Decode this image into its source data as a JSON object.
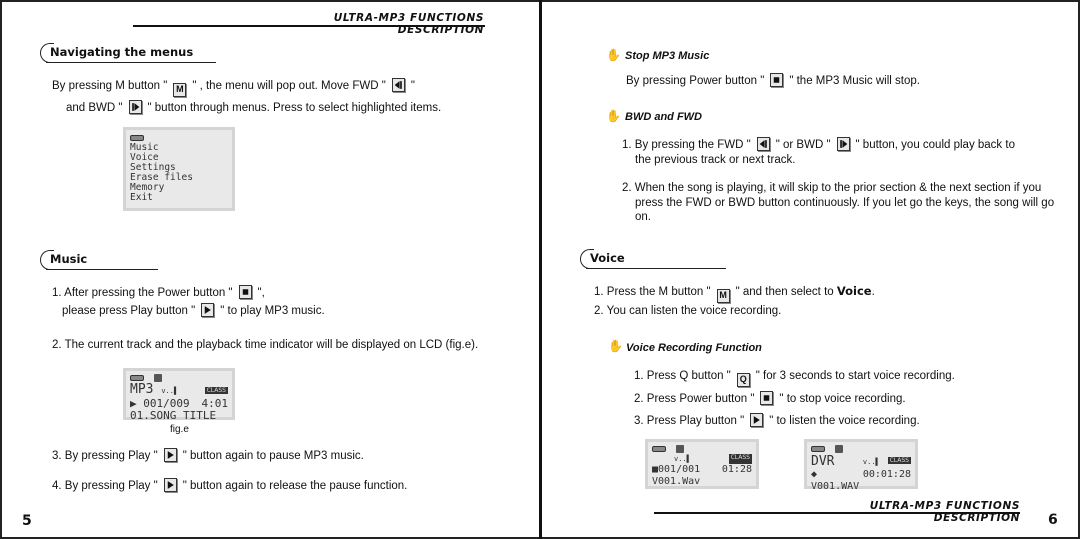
{
  "document": {
    "header_title": "ULTRA-MP3 FUNCTIONS DESCRIPTION",
    "left_page_number": "5",
    "right_page_number": "6"
  },
  "left": {
    "nav_section": {
      "title": "Navigating the menus",
      "line1_a": "By pressing M button \"",
      "line1_btn": "M",
      "line1_b": "\" , the menu will pop out. Move FWD \"",
      "line1_c": "\"",
      "line2_a": "and BWD \"",
      "line2_b": "\" button through menus. Press to select highlighted items."
    },
    "menu_lcd": {
      "items": [
        "Music",
        "Voice",
        "Settings",
        "Erase files",
        "Memory",
        "Exit"
      ]
    },
    "music_section": {
      "title": "Music",
      "step1_a": "1. After pressing the Power  button \"",
      "step1_b": "\",",
      "step1_c": "please press Play  button \"",
      "step1_d": "\" to play MP3 music.",
      "step2": "2. The current track and the playback time indicator will be displayed on LCD (fig.e).",
      "step3_a": "3. By pressing Play \"",
      "step3_b": "\" button again to pause MP3 music.",
      "step4_a": "4. By pressing Play \"",
      "step4_b": "\" button again to release the pause function."
    },
    "fig_e": {
      "mode": "MP3",
      "signal": "v..▌",
      "badge": "CLASS",
      "track": "▶ 001/009",
      "time": "4:01",
      "title": "01.SONG TITLE",
      "caption": "fig.e"
    }
  },
  "right": {
    "stop_section": {
      "title": "Stop MP3 Music",
      "text_a": "By pressing Power button \"",
      "text_b": "\" the MP3 Music will stop."
    },
    "bwd_fwd_section": {
      "title": "BWD and FWD",
      "step1_a": "1. By pressing the FWD \"",
      "step1_b": "\" or BWD \"",
      "step1_c": "\" button, you could play back to",
      "step1_d": "the previous track or next track.",
      "step2": "2. When the song is playing, it will skip to the prior section & the next section if you press the FWD or BWD button continuously. If you let go the keys, the song will go on."
    },
    "voice_section": {
      "title": "Voice",
      "step1_a": "1. Press the M button \"",
      "step1_btn": "M",
      "step1_b": "\" and then select to ",
      "step1_bold": "Voice",
      "step1_c": ".",
      "step2": "2. You can listen the voice recording."
    },
    "voice_rec_section": {
      "title": "Voice Recording Function",
      "step1_a": "1. Press Q button \"",
      "step1_btn": "Q",
      "step1_b": "\" for 3 seconds to start voice recording.",
      "step2_a": "2. Press Power button \"",
      "step2_b": "\" to stop voice recording.",
      "step3_a": "3. Press Play button \"",
      "step3_b": "\"  to listen the voice recording."
    },
    "lcd_play": {
      "signal": "v..▌",
      "badge": "CLASS",
      "track": "■001/001",
      "time": "01:28",
      "file": "V001.Wav"
    },
    "lcd_dvr": {
      "mode": "DVR",
      "signal": "v..▌",
      "badge": "CLASS",
      "indicator": "◆",
      "time": "00:01:28",
      "file": "V001.WAV"
    }
  }
}
